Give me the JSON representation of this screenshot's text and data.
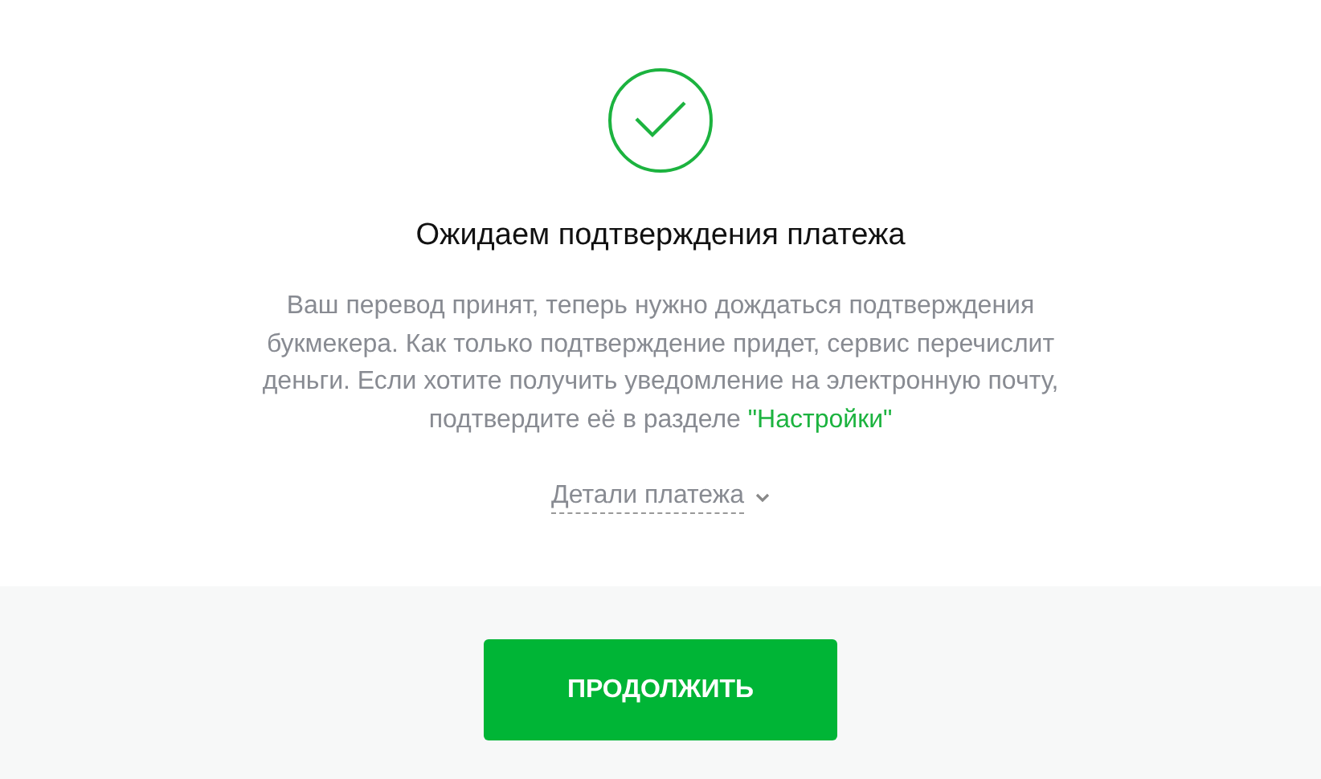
{
  "status": {
    "kind": "success"
  },
  "title": "Ожидаем подтверждения платежа",
  "message": {
    "text": "Ваш перевод принят, теперь нужно дождаться подтверждения букмекера. Как только подтверждение придет, сервис перечислит деньги. Если хотите получить уведомление на электронную почту, подтвердите её в разделе",
    "link": "\"Настройки\""
  },
  "details": {
    "label": "Детали платежа",
    "expanded": false
  },
  "button": "ПРОДОЛЖИТЬ"
}
